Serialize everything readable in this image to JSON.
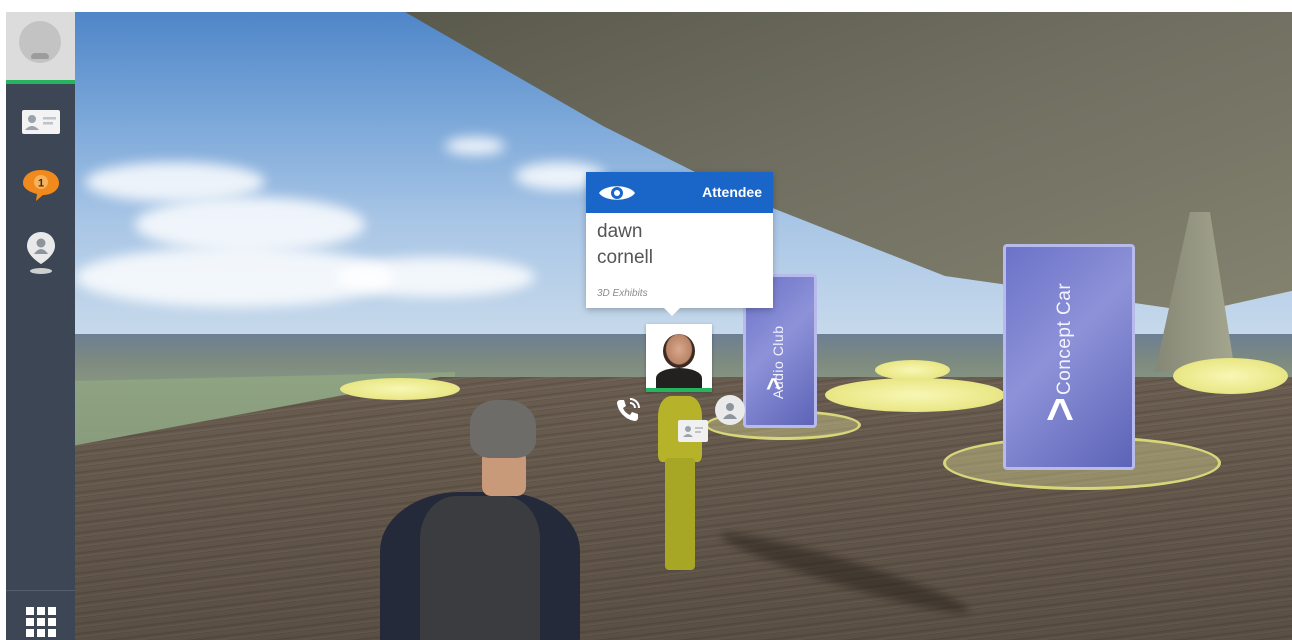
{
  "sidebar": {
    "items": [
      {
        "name": "profile-avatar",
        "icon": "user-avatar-icon"
      },
      {
        "name": "business-card",
        "icon": "business-card-icon"
      },
      {
        "name": "notifications",
        "icon": "chat-bubble-icon",
        "badge": "1"
      },
      {
        "name": "location",
        "icon": "map-pin-icon"
      },
      {
        "name": "menu",
        "icon": "grid-icon"
      }
    ]
  },
  "attendee_popup": {
    "role": "Attendee",
    "first_name": "dawn",
    "last_name": "cornell",
    "location": "3D Exhibits"
  },
  "kiosks": {
    "left_label": "Audio Club",
    "right_label": "Concept Car"
  },
  "colors": {
    "sidebar_bg": "#3c4654",
    "popup_header": "#1a65c8",
    "online_green": "#27b45e",
    "badge_orange": "#f08a1d"
  }
}
